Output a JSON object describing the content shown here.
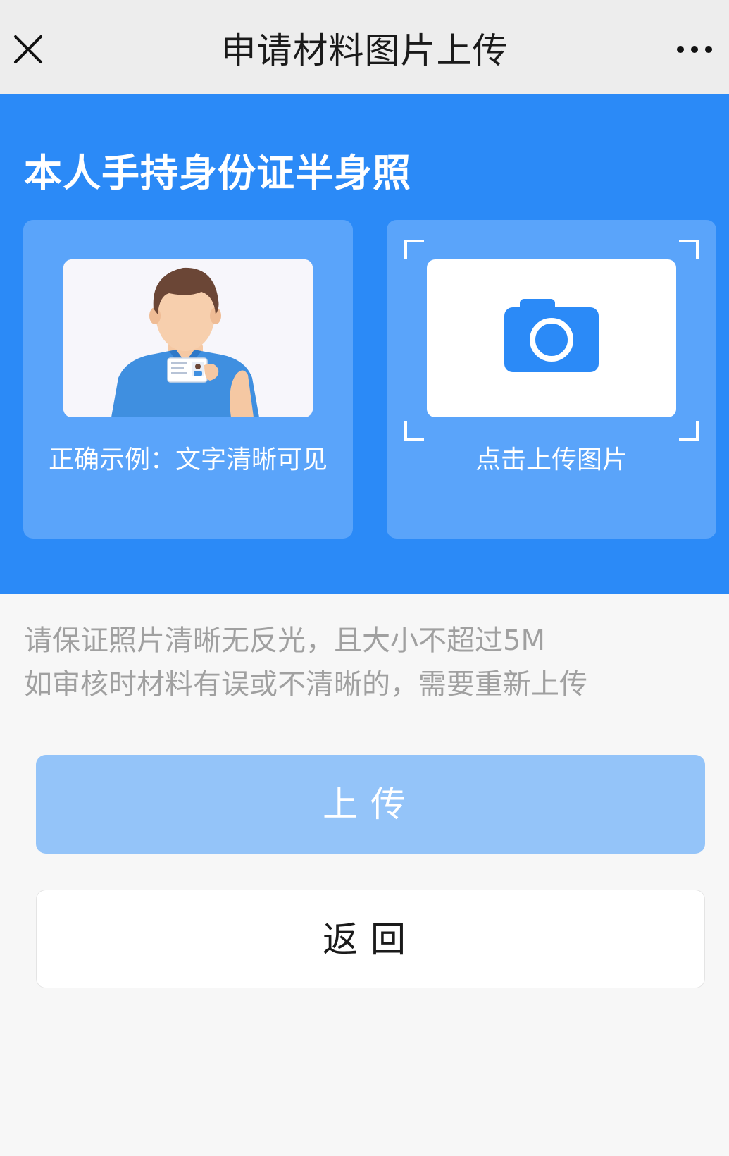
{
  "nav": {
    "title": "申请材料图片上传",
    "close_icon": "close-icon",
    "more_icon": "more-dots-icon"
  },
  "hero": {
    "title": "本人手持身份证半身照",
    "background_color": "#2b8af7",
    "example_card": {
      "illustration": "person-holding-id-card-illustration",
      "caption": "正确示例：文字清晰可见"
    },
    "upload_card": {
      "icon": "camera-icon",
      "caption": "点击上传图片"
    }
  },
  "notes": {
    "line1": "请保证照片清晰无反光，且大小不超过5M",
    "line2": "如审核时材料有误或不清晰的，需要重新上传"
  },
  "buttons": {
    "upload_label": "上传",
    "upload_color": "#94c4f9",
    "back_label": "返回"
  }
}
